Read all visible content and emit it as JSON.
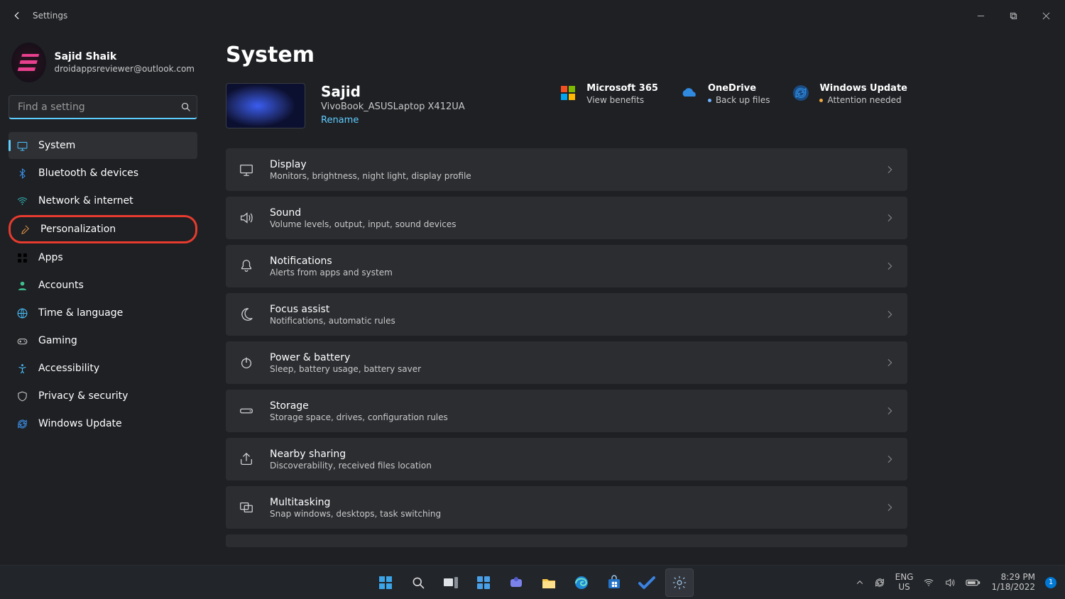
{
  "app": {
    "title": "Settings"
  },
  "profile": {
    "name": "Sajid Shaik",
    "email": "droidappsreviewer@outlook.com"
  },
  "search": {
    "placeholder": "Find a setting"
  },
  "sidebar": {
    "items": [
      {
        "icon": "system-icon",
        "label": "System",
        "selected": true
      },
      {
        "icon": "bluetooth-icon",
        "label": "Bluetooth & devices"
      },
      {
        "icon": "wifi-icon",
        "label": "Network & internet"
      },
      {
        "icon": "brush-icon",
        "label": "Personalization",
        "highlighted": true
      },
      {
        "icon": "apps-icon",
        "label": "Apps"
      },
      {
        "icon": "person-icon",
        "label": "Accounts"
      },
      {
        "icon": "globe-icon",
        "label": "Time & language"
      },
      {
        "icon": "gamepad-icon",
        "label": "Gaming"
      },
      {
        "icon": "accessibility-icon",
        "label": "Accessibility"
      },
      {
        "icon": "shield-icon",
        "label": "Privacy & security"
      },
      {
        "icon": "update-icon",
        "label": "Windows Update"
      }
    ]
  },
  "page": {
    "title": "System"
  },
  "device": {
    "name": "Sajid",
    "model": "VivoBook_ASUSLaptop X412UA",
    "rename_label": "Rename"
  },
  "status": [
    {
      "icon": "m365-icon",
      "title": "Microsoft 365",
      "sub": "View benefits",
      "dot": null
    },
    {
      "icon": "onedrive-icon",
      "title": "OneDrive",
      "sub": "Back up files",
      "dot": "#6fb2ff"
    },
    {
      "icon": "update-circle-icon",
      "title": "Windows Update",
      "sub": "Attention needed",
      "dot": "#f0a840"
    }
  ],
  "cards": [
    {
      "icon": "display-icon",
      "title": "Display",
      "desc": "Monitors, brightness, night light, display profile"
    },
    {
      "icon": "sound-icon",
      "title": "Sound",
      "desc": "Volume levels, output, input, sound devices"
    },
    {
      "icon": "bell-icon",
      "title": "Notifications",
      "desc": "Alerts from apps and system"
    },
    {
      "icon": "moon-icon",
      "title": "Focus assist",
      "desc": "Notifications, automatic rules"
    },
    {
      "icon": "power-icon",
      "title": "Power & battery",
      "desc": "Sleep, battery usage, battery saver"
    },
    {
      "icon": "storage-icon",
      "title": "Storage",
      "desc": "Storage space, drives, configuration rules"
    },
    {
      "icon": "share-icon",
      "title": "Nearby sharing",
      "desc": "Discoverability, received files location"
    },
    {
      "icon": "multitask-icon",
      "title": "Multitasking",
      "desc": "Snap windows, desktops, task switching"
    }
  ],
  "taskbar": {
    "center": [
      {
        "icon": "start-icon"
      },
      {
        "icon": "search-icon"
      },
      {
        "icon": "taskview-icon"
      },
      {
        "icon": "widgets-icon"
      },
      {
        "icon": "teams-icon"
      },
      {
        "icon": "explorer-icon"
      },
      {
        "icon": "edge-icon"
      },
      {
        "icon": "store-icon"
      },
      {
        "icon": "todo-icon"
      },
      {
        "icon": "settings-icon",
        "active": true
      }
    ],
    "tray": {
      "lang_top": "ENG",
      "lang_bot": "US",
      "time": "8:29 PM",
      "date": "1/18/2022",
      "notif_count": "1"
    }
  }
}
